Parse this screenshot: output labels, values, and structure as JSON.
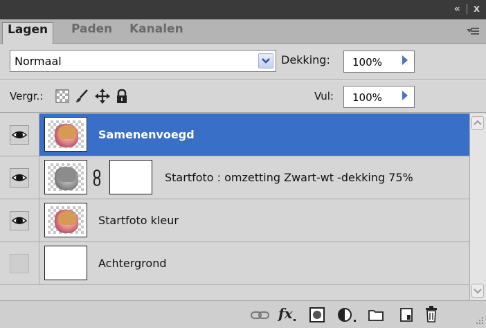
{
  "window_controls": {
    "collapse": "44",
    "close": "x"
  },
  "tabs": [
    {
      "label": "Lagen",
      "active": true
    },
    {
      "label": "Paden",
      "active": false
    },
    {
      "label": "Kanalen",
      "active": false
    }
  ],
  "blend_mode": {
    "value": "Normaal"
  },
  "opacity": {
    "label": "Dekking:",
    "value": "100%"
  },
  "lock": {
    "label": "Vergr.:",
    "icons": [
      "lock-transparent-icon",
      "lock-paint-icon",
      "lock-move-icon",
      "lock-all-icon"
    ]
  },
  "fill": {
    "label": "Vul:",
    "value": "100%"
  },
  "layers": [
    {
      "name": "Samenenvoegd",
      "visible": true,
      "selected": true,
      "thumb": "color-photo"
    },
    {
      "name": "Startfoto : omzetting Zwart-wt -dekking 75%",
      "visible": true,
      "selected": false,
      "thumb": "gray-photo",
      "mask": true
    },
    {
      "name": "Startfoto kleur",
      "visible": true,
      "selected": false,
      "thumb": "color-photo"
    },
    {
      "name": "Achtergrond",
      "visible": false,
      "selected": false,
      "thumb": "white"
    }
  ],
  "bottom_icons": [
    "link-layers-icon",
    "fx-icon",
    "add-mask-icon",
    "adjustment-layer-icon",
    "new-group-icon",
    "new-layer-icon",
    "trash-icon"
  ],
  "colors": {
    "panel": "#d6d6d6",
    "selected_row": "#3a6fc7",
    "titlebar": "#3a3a3a",
    "tabs_bg": "#b4b4b4"
  }
}
